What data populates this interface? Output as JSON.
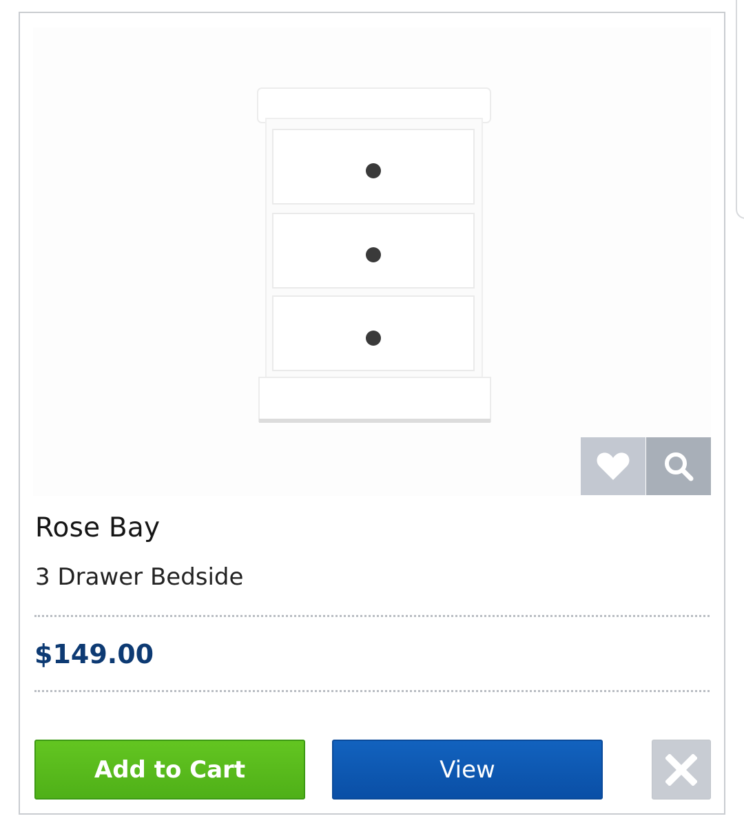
{
  "product": {
    "name": "Rose Bay",
    "description": "3 Drawer Bedside",
    "price": "$149.00",
    "image_alt": "White 3 drawer bedside table"
  },
  "actions": {
    "add_to_cart_label": "Add to Cart",
    "view_label": "View",
    "wishlist_icon": "heart-icon",
    "zoom_icon": "search-icon",
    "remove_icon": "close-icon"
  },
  "colors": {
    "price": "#0d3a73",
    "add_to_cart": "#5bbd1e",
    "view": "#0b57b0",
    "close_button": "#c8ccd3",
    "wishlist_button": "#c3c8d1",
    "zoom_button": "#a8afb8"
  }
}
